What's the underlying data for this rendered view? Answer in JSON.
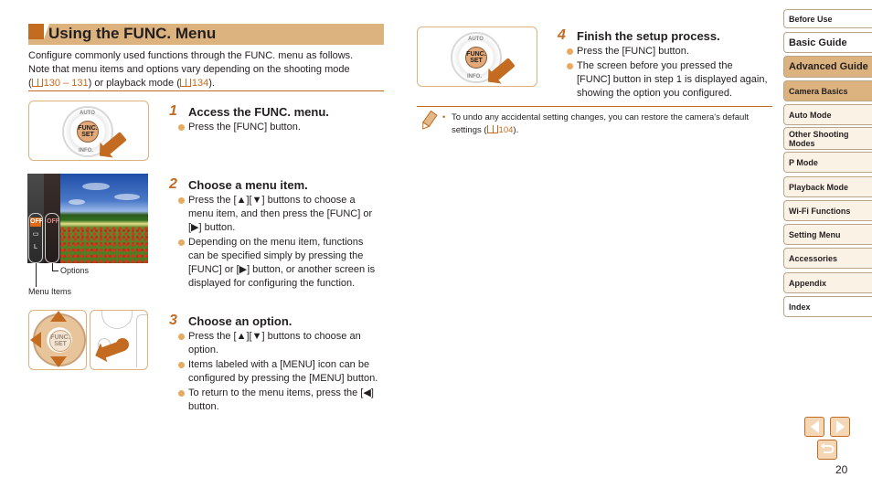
{
  "section": {
    "title": "Using the FUNC. Menu",
    "intro_line1": "Configure commonly used functions through the FUNC. menu as follows.",
    "intro_line2": "Note that menu items and options vary depending on the shooting mode",
    "intro_open": "(",
    "intro_ref1": "130 – 131",
    "intro_mid": ") or playback mode (",
    "intro_ref2": "134",
    "intro_close": ")."
  },
  "steps": [
    {
      "number": "1",
      "title": "Access the FUNC. menu.",
      "bullets": [
        "Press the [FUNC] button."
      ]
    },
    {
      "number": "2",
      "title": "Choose a menu item.",
      "bullets": [
        "Press the [▲][▼] buttons to choose a menu item, and then press the [FUNC] or [▶] button.",
        "Depending on the menu item, functions can be specified simply by pressing the [FUNC] or [▶] button, or another screen is displayed for configuring the function."
      ],
      "callouts": {
        "options": "Options",
        "menu_items": "Menu Items"
      }
    },
    {
      "number": "3",
      "title": "Choose an option.",
      "bullets": [
        "Press the [▲][▼] buttons to choose an option.",
        "Items labeled with a [MENU] icon can be configured by pressing the [MENU] button.",
        "To return to the menu items, press the [◀] button."
      ]
    },
    {
      "number": "4",
      "title": "Finish the setup process.",
      "bullets": [
        "Press the [FUNC] button.",
        "The screen before you pressed the [FUNC] button in step 1 is displayed again, showing the option you configured."
      ]
    }
  ],
  "illustrations": {
    "func_button": "FUNC.",
    "set_label": "SET",
    "info_label": "INFO.",
    "auto_label": "AUTO",
    "menu_item_off": "OFF",
    "menu_item_size": "L"
  },
  "note": {
    "text_before": "To undo any accidental setting changes, you can restore the camera's default settings (",
    "ref": "104",
    "text_after": ")."
  },
  "sidebar": {
    "tabs": [
      {
        "label": "Before Use",
        "state": "normal"
      },
      {
        "label": "Basic Guide",
        "state": "normal"
      },
      {
        "label": "Advanced Guide",
        "state": "active"
      },
      {
        "label": "Camera Basics",
        "state": "active-sub"
      },
      {
        "label": "Auto Mode",
        "state": "normal"
      },
      {
        "label": "Other Shooting Modes",
        "state": "normal"
      },
      {
        "label": "P Mode",
        "state": "normal"
      },
      {
        "label": "Playback Mode",
        "state": "normal"
      },
      {
        "label": "Wi-Fi Functions",
        "state": "normal"
      },
      {
        "label": "Setting Menu",
        "state": "normal"
      },
      {
        "label": "Accessories",
        "state": "normal"
      },
      {
        "label": "Appendix",
        "state": "normal"
      },
      {
        "label": "Index",
        "state": "normal"
      }
    ]
  },
  "navigation": {
    "prev_icon": "arrow-left",
    "next_icon": "arrow-right",
    "return_icon": "return-arrow",
    "page_number": "20"
  },
  "colors": {
    "accent": "#c36b21",
    "header_bar": "#dcb27e",
    "bullet": "#e8a960"
  }
}
